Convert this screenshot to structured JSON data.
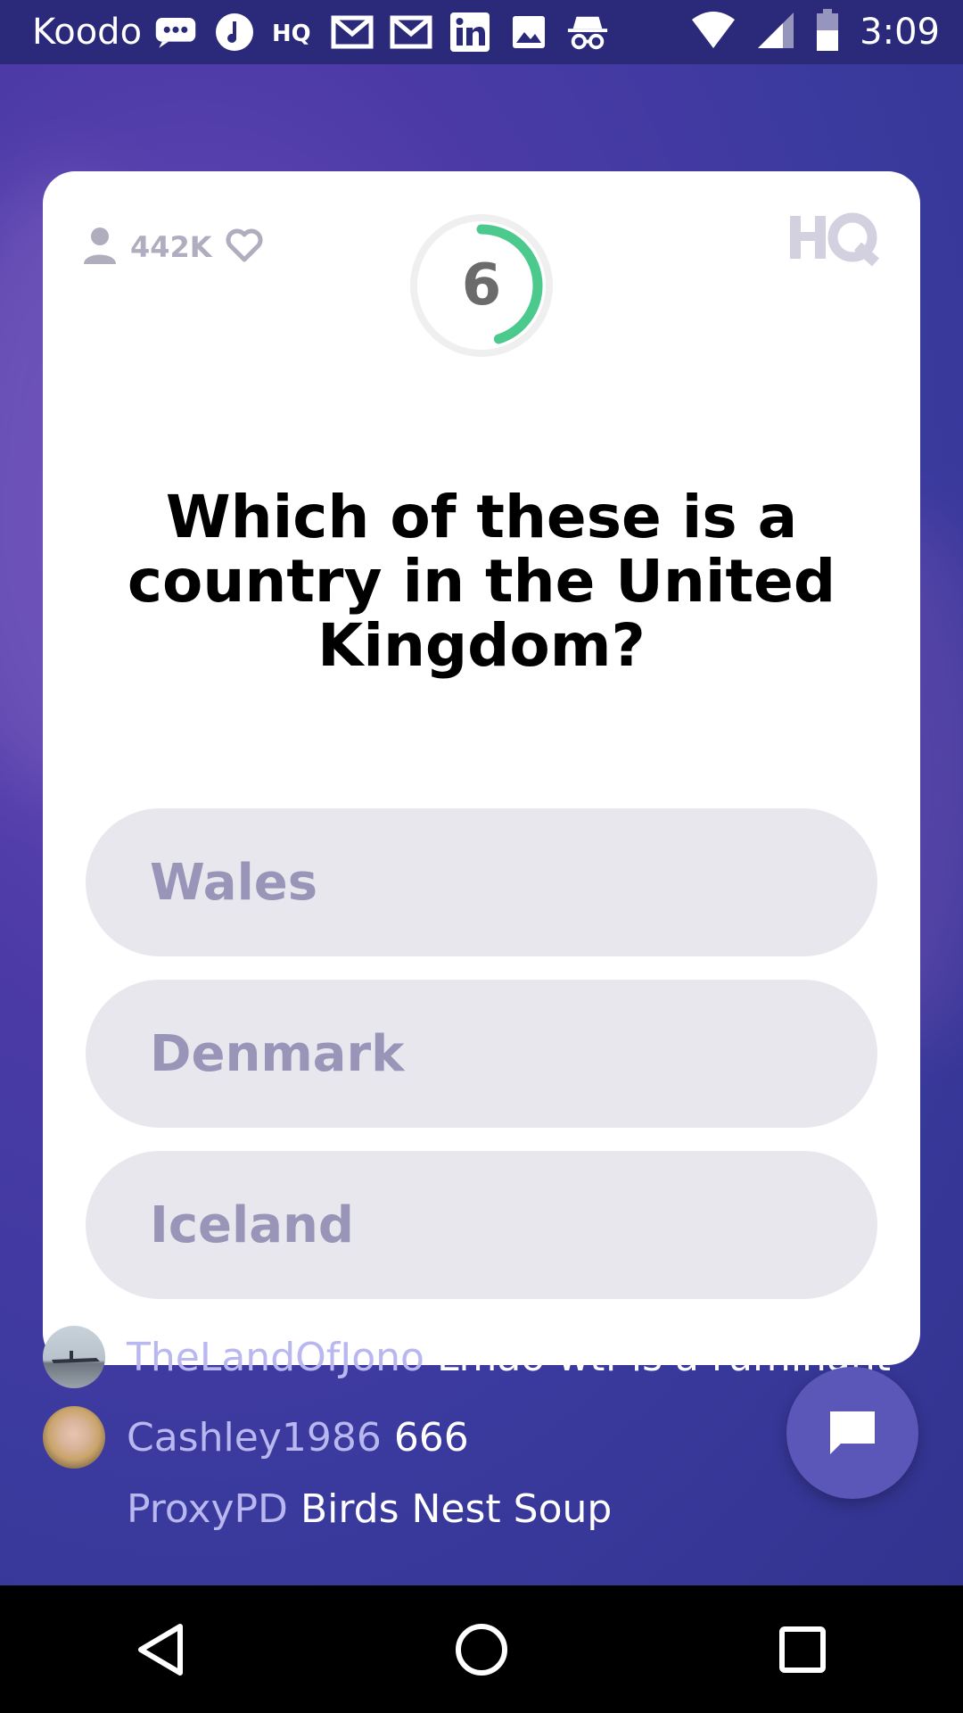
{
  "status_bar": {
    "carrier": "Koodo",
    "time": "3:09",
    "notification_icons": [
      "chat-bubble-icon",
      "music-icon",
      "hq-icon",
      "gmail-icon",
      "gmail-icon",
      "linkedin-icon",
      "photo-icon",
      "incognito-icon"
    ],
    "system_icons": [
      "wifi-icon",
      "signal-icon",
      "battery-icon"
    ]
  },
  "card": {
    "viewer_count": "442K",
    "timer": "6",
    "timer_remaining_fraction": 0.45,
    "logo": "HQ",
    "question": "Which of these is a country in the United Kingdom?",
    "answers": [
      "Wales",
      "Denmark",
      "Iceland"
    ]
  },
  "chat": {
    "messages": [
      {
        "user": "TheLandOfJono",
        "text": "Lmao wtf is a ruminant"
      },
      {
        "user": "Cashley1986",
        "text": "666"
      },
      {
        "user": "ProxyPD",
        "text": "Birds Nest Soup"
      }
    ]
  },
  "colors": {
    "timer_green": "#4cc98c",
    "answer_bg": "#e8e7ee",
    "answer_text": "#9995b8",
    "chat_user": "#b9b7ef"
  }
}
